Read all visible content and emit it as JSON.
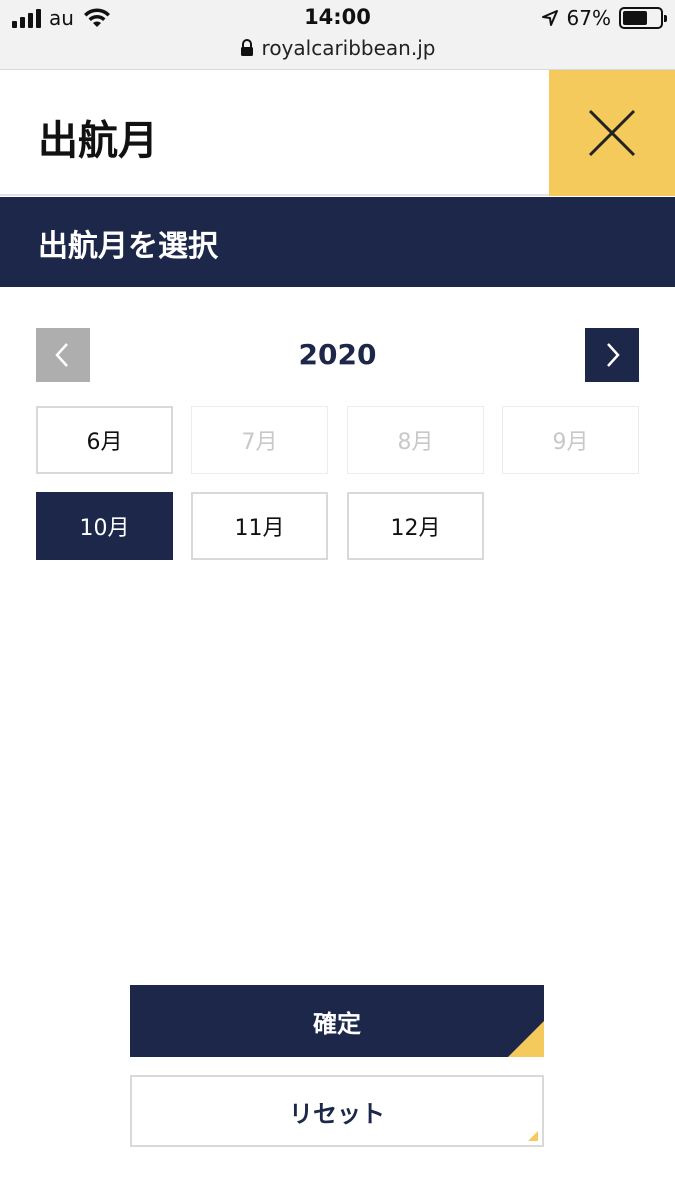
{
  "status_bar": {
    "carrier": "au",
    "time": "14:00",
    "battery_percent_label": "67%",
    "battery_level": 0.67,
    "url": "royalcaribbean.jp"
  },
  "header": {
    "title": "出航月",
    "close_icon": "close-x-icon",
    "accent_color": "#f5ca5c"
  },
  "subheader": {
    "title": "出航月を選択",
    "bg_color": "#1c2749"
  },
  "year_nav": {
    "year": "2020",
    "prev_icon": "chevron-left-icon",
    "next_icon": "chevron-right-icon"
  },
  "months": [
    {
      "label": "6月",
      "state": "enabled"
    },
    {
      "label": "7月",
      "state": "disabled"
    },
    {
      "label": "8月",
      "state": "disabled"
    },
    {
      "label": "9月",
      "state": "disabled"
    },
    {
      "label": "10月",
      "state": "selected"
    },
    {
      "label": "11月",
      "state": "enabled"
    },
    {
      "label": "12月",
      "state": "enabled"
    }
  ],
  "actions": {
    "confirm_label": "確定",
    "reset_label": "リセット"
  }
}
